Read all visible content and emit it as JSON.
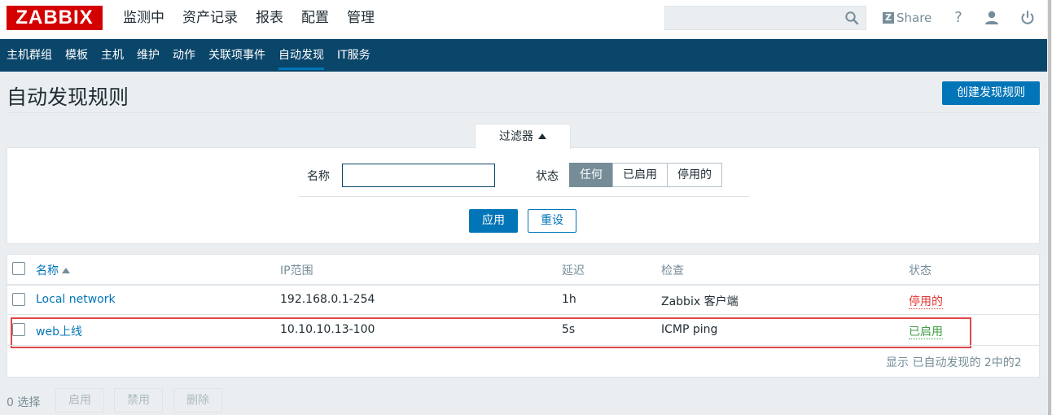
{
  "header": {
    "logo": "ZABBIX",
    "menu": [
      "监测中",
      "资产记录",
      "报表",
      "配置",
      "管理"
    ],
    "share_label": "Share",
    "help_label": "?"
  },
  "submenu": [
    "主机群组",
    "模板",
    "主机",
    "维护",
    "动作",
    "关联项事件",
    "自动发现",
    "IT服务"
  ],
  "page": {
    "title": "自动发现规则",
    "create_button": "创建发现规则"
  },
  "filter": {
    "tab_label": "过滤器",
    "name_label": "名称",
    "name_value": "",
    "status_label": "状态",
    "status_options": [
      "任何",
      "已启用",
      "停用的"
    ],
    "selected_status": "任何",
    "apply_label": "应用",
    "reset_label": "重设"
  },
  "table": {
    "headers": {
      "name": "名称",
      "ip_range": "IP范围",
      "delay": "延迟",
      "checks": "检查",
      "status": "状态"
    },
    "rows": [
      {
        "name": "Local network",
        "ip_range": "192.168.0.1-254",
        "delay": "1h",
        "checks": "Zabbix 客户端",
        "status": "停用的",
        "status_color": "#e33734"
      },
      {
        "name": "web上线",
        "ip_range": "10.10.10.13-100",
        "delay": "5s",
        "checks": "ICMP ping",
        "status": "已启用",
        "status_color": "#429e47"
      }
    ],
    "summary": "显示 已自动发现的 2中的2"
  },
  "footer": {
    "selected_count": "0 选择",
    "enable_label": "启用",
    "disable_label": "禁用",
    "delete_label": "删除"
  },
  "colors": {
    "brand_red": "#d40000",
    "nav_blue": "#0a466a",
    "primary": "#0275b8",
    "disabled_status": "#e33734",
    "enabled_status": "#429e47",
    "highlight_border": "#e0474a"
  }
}
